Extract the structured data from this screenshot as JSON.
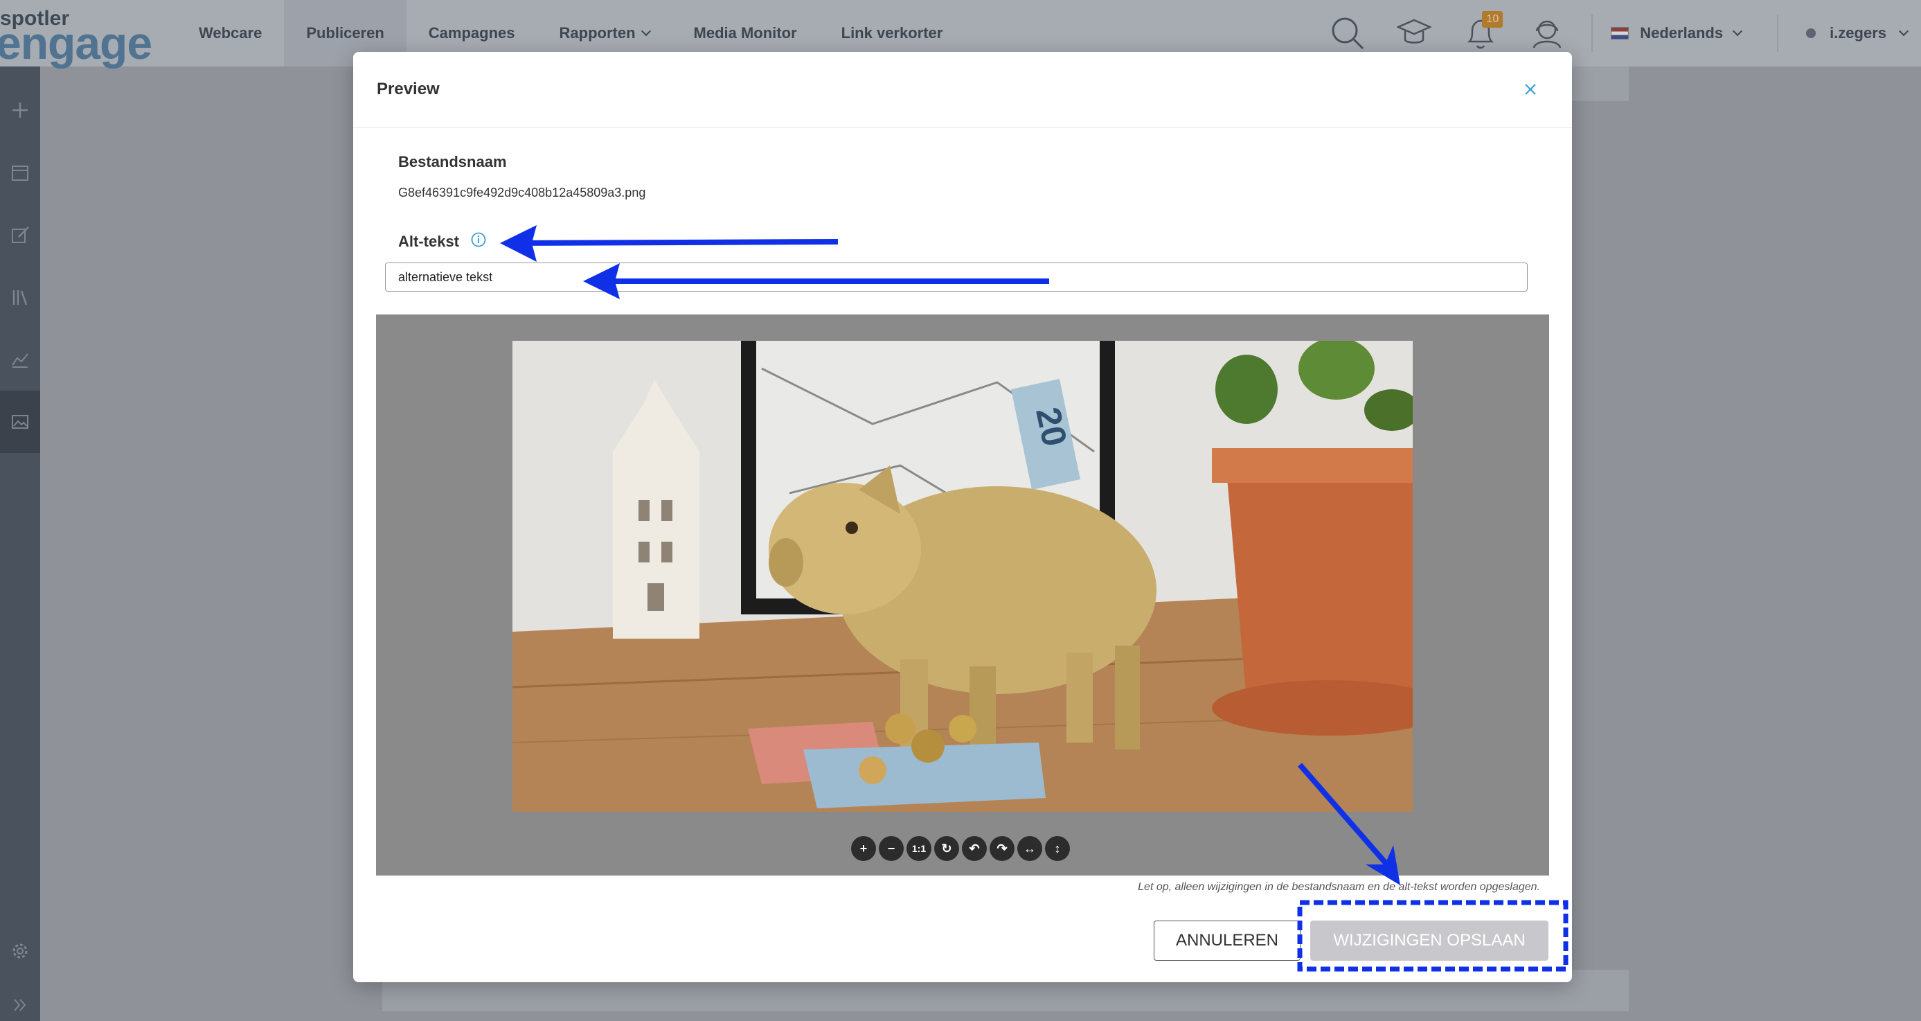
{
  "app": {
    "logo_small": "spotler",
    "logo_large": "engage"
  },
  "nav": {
    "items": [
      {
        "label": "Webcare"
      },
      {
        "label": "Publiceren"
      },
      {
        "label": "Campagnes"
      },
      {
        "label": "Rapporten"
      },
      {
        "label": "Media Monitor"
      },
      {
        "label": "Link verkorter"
      }
    ],
    "active": "Publiceren"
  },
  "topbar": {
    "notifications_count": "10",
    "language": "Nederlands",
    "username": "i.zegers"
  },
  "modal": {
    "title": "Preview",
    "filename_label": "Bestandsnaam",
    "filename_value": "G8ef46391c9fe492d9c408b12a45809a3.png",
    "alt_label": "Alt-tekst",
    "alt_value": "alternatieve tekst",
    "toolbar": [
      "zoom-in",
      "zoom-out",
      "1:1",
      "reset",
      "rotate-left",
      "rotate-right",
      "flip-horizontal",
      "flip-vertical"
    ],
    "toolbar_1to1_label": "1:1",
    "note": "Let op, alleen wijzigingen in de bestandsnaam en de alt-tekst worden opgeslagen.",
    "cancel_label": "ANNULEREN",
    "save_label": "WIJZIGINGEN OPSLAAN"
  },
  "colors": {
    "annotation_blue": "#1030e8",
    "sidebar": "#4a525d",
    "save_button": "#c8c8cc"
  }
}
